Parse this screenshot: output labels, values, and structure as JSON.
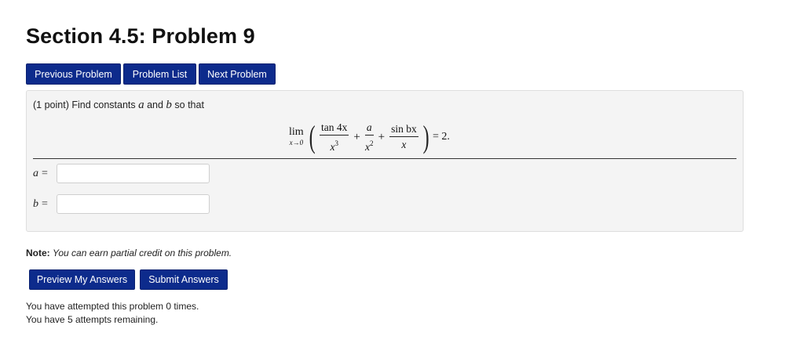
{
  "page": {
    "title": "Section 4.5: Problem 9"
  },
  "nav": {
    "previous_label": "Previous Problem",
    "list_label": "Problem List",
    "next_label": "Next Problem"
  },
  "problem": {
    "prefix": "(1 point) Find constants ",
    "var_a": "a",
    "and_text": " and ",
    "var_b": "b",
    "suffix": " so that",
    "equation": {
      "lim_word": "lim",
      "lim_sub": "x→0",
      "frac1_num": "tan 4x",
      "frac1_den": "x",
      "frac1_den_exp": "3",
      "plus1": "+",
      "frac2_num": "a",
      "frac2_den": "x",
      "frac2_den_exp": "2",
      "plus2": "+",
      "frac3_num": "sin bx",
      "frac3_den": "x",
      "rhs": "= 2."
    }
  },
  "answers": {
    "a_label": "a",
    "b_label": "b",
    "equals": "=",
    "a_value": "",
    "b_value": ""
  },
  "note": {
    "label": "Note:",
    "text": "You can earn partial credit on this problem."
  },
  "actions": {
    "preview_label": "Preview My Answers",
    "submit_label": "Submit Answers"
  },
  "status": {
    "attempted": "You have attempted this problem 0 times.",
    "remaining": "You have 5 attempts remaining."
  }
}
